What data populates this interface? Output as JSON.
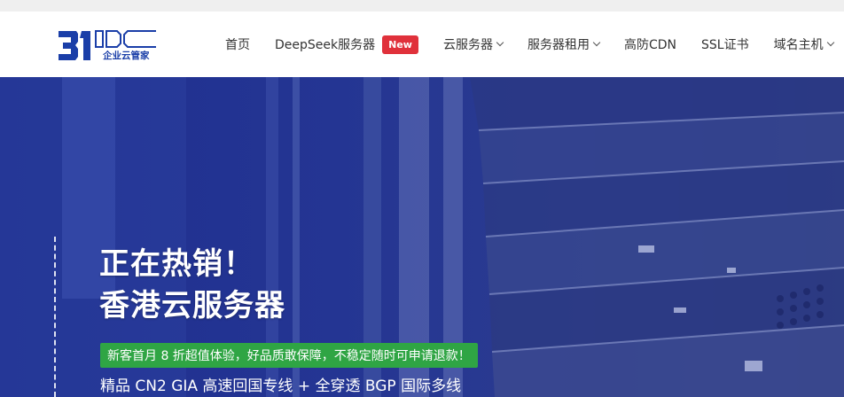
{
  "logo": {
    "text_main": "31IDC",
    "text_sub": "企业云管家"
  },
  "nav": {
    "home": "首页",
    "deepseek": "DeepSeek服务器",
    "deepseek_badge": "New",
    "cloud": "云服务器",
    "rental": "服务器租用",
    "cdn": "高防CDN",
    "ssl": "SSL证书",
    "domain": "域名主机"
  },
  "hero": {
    "title_line1": "正在热销！",
    "title_line2": "香港云服务器",
    "promo": "新客首月 8 折超值体验，好品质敢保障，不稳定随时可申请退款！",
    "subtitle": "精品 CN2 GIA 高速回国专线 + 全穿透 BGP 国际多线"
  },
  "colors": {
    "brand_blue": "#1a3ea8",
    "badge_red": "#e0313b",
    "promo_green": "#2fa544",
    "hero_blue": "#243593"
  }
}
